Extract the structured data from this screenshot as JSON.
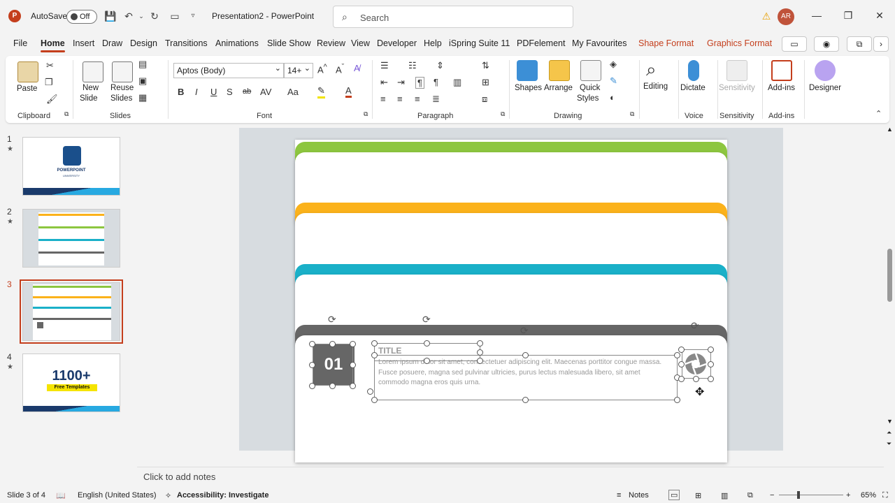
{
  "titlebar": {
    "app_logo": "P",
    "autosave_label": "AutoSave",
    "autosave_state": "Off",
    "doc_title": "Presentation2  -  PowerPoint",
    "search_placeholder": "Search",
    "avatar_initials": "AR"
  },
  "tabs": [
    {
      "label": "File"
    },
    {
      "label": "Home"
    },
    {
      "label": "Insert"
    },
    {
      "label": "Draw"
    },
    {
      "label": "Design"
    },
    {
      "label": "Transitions"
    },
    {
      "label": "Animations"
    },
    {
      "label": "Slide Show"
    },
    {
      "label": "Review"
    },
    {
      "label": "View"
    },
    {
      "label": "Developer"
    },
    {
      "label": "Help"
    },
    {
      "label": "iSpring Suite 11"
    },
    {
      "label": "PDFelement"
    },
    {
      "label": "My Favourites"
    },
    {
      "label": "Shape Format"
    },
    {
      "label": "Graphics Format"
    }
  ],
  "ribbon": {
    "clipboard": {
      "paste": "Paste",
      "group": "Clipboard"
    },
    "slides": {
      "new_slide_1": "New",
      "new_slide_2": "Slide",
      "reuse_1": "Reuse",
      "reuse_2": "Slides",
      "group": "Slides"
    },
    "font": {
      "name": "Aptos (Body)",
      "size": "14+",
      "bold": "B",
      "italic": "I",
      "underline": "U",
      "strike": "ab",
      "spacing": "AV",
      "case": "Aa",
      "group": "Font"
    },
    "paragraph": {
      "group": "Paragraph"
    },
    "drawing": {
      "shapes": "Shapes",
      "arrange": "Arrange",
      "quick_1": "Quick",
      "quick_2": "Styles",
      "group": "Drawing"
    },
    "editing": {
      "label": "Editing"
    },
    "voice": {
      "dictate": "Dictate",
      "group": "Voice"
    },
    "sensitivity": {
      "label": "Sensitivity",
      "group": "Sensitivity"
    },
    "addins": {
      "label": "Add-ins",
      "group": "Add-ins"
    },
    "designer": {
      "label": "Designer"
    }
  },
  "thumbnails": [
    {
      "num": "1",
      "title": "POWERPOINT",
      "subtitle": "UNIVERSITY"
    },
    {
      "num": "2"
    },
    {
      "num": "3"
    },
    {
      "num": "4",
      "big": "1100+",
      "tag": "Free Templates"
    }
  ],
  "slide": {
    "number": "01",
    "title": "TITLE",
    "body": "Lorem ipsum dolor sit amet, consectetuer adipiscing elit. Maecenas porttitor congue massa. Fusce posuere, magna sed pulvinar ultricies, purus lectus malesuada libero, sit amet commodo magna eros quis urna.",
    "colors": {
      "green": "#8dc63f",
      "orange": "#fbb21b",
      "teal": "#1ab0c8",
      "gray": "#666666"
    }
  },
  "notes_placeholder": "Click to add notes",
  "status": {
    "slide_info": "Slide 3 of 4",
    "language": "English (United States)",
    "accessibility": "Accessibility: Investigate",
    "notes": "Notes",
    "zoom": "65%"
  }
}
